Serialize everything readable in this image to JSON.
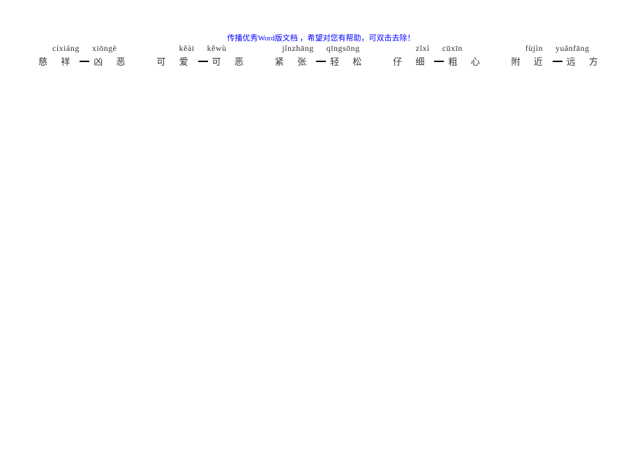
{
  "header_note": "传播优秀Word版文档 ，希望对您有帮助，可双击去除！",
  "pairs": [
    {
      "pinyin_left": "cíxiáng",
      "pinyin_right": "xiōngè",
      "hanzi_left": "慈 祥",
      "hanzi_right": "凶 恶"
    },
    {
      "pinyin_left": "kěài",
      "pinyin_right": "kěwù",
      "hanzi_left": "可 爱",
      "hanzi_right": "可 恶"
    },
    {
      "pinyin_left": "jǐnzhāng",
      "pinyin_right": "qīngsōng",
      "hanzi_left": "紧 张",
      "hanzi_right": "轻 松"
    },
    {
      "pinyin_left": "zǐxì",
      "pinyin_right": "cūxīn",
      "hanzi_left": "仔 细",
      "hanzi_right": "粗 心"
    },
    {
      "pinyin_left": "fùjìn",
      "pinyin_right": "yuǎnfāng",
      "hanzi_left": "附 近",
      "hanzi_right": "远 方"
    }
  ]
}
